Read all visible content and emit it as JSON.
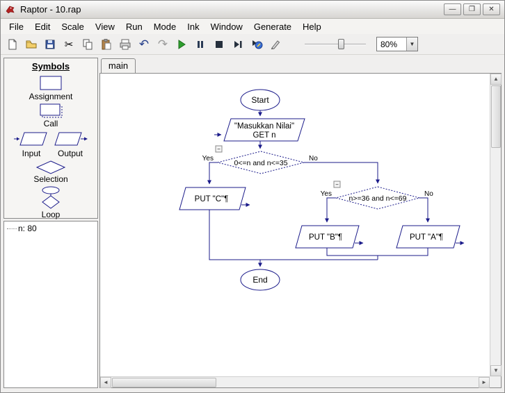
{
  "window": {
    "title": "Raptor - 10.rap",
    "controls": {
      "minimize": "—",
      "maximize": "❐",
      "close": "✕"
    }
  },
  "menu": {
    "items": [
      "File",
      "Edit",
      "Scale",
      "View",
      "Run",
      "Mode",
      "Ink",
      "Window",
      "Generate",
      "Help"
    ]
  },
  "toolbar": {
    "zoom_value": "80%",
    "icons": [
      "new",
      "open",
      "save",
      "cut",
      "copy",
      "paste",
      "print",
      "undo",
      "redo",
      "run",
      "pause",
      "stop",
      "step",
      "run-to",
      "pen"
    ]
  },
  "sidebar": {
    "header": "Symbols",
    "symbols": [
      {
        "label": "Assignment"
      },
      {
        "label": "Call"
      },
      {
        "label": "Input"
      },
      {
        "label": "Output"
      },
      {
        "label": "Selection"
      },
      {
        "label": "Loop"
      }
    ],
    "watch": {
      "item": "n: 80"
    }
  },
  "main": {
    "tab": "main"
  },
  "flowchart": {
    "start_label": "Start",
    "input_line1": "\"Masukkan Nilai\"",
    "input_line2": "GET n",
    "sel1": {
      "condition": "0<=n and n<=35",
      "yes": "Yes",
      "no": "No",
      "collapse": "−"
    },
    "put_c": "PUT \"C\"¶",
    "sel2": {
      "condition": "n>=36 and n<=69",
      "yes": "Yes",
      "no": "No",
      "collapse": "−"
    },
    "put_b": "PUT \"B\"¶",
    "put_a": "PUT \"A\"¶",
    "end_label": "End"
  }
}
